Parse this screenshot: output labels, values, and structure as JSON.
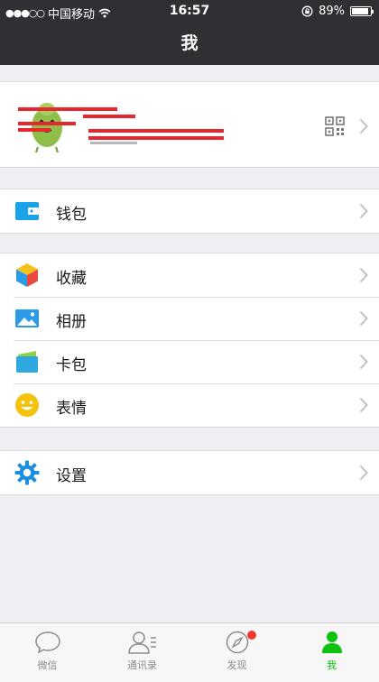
{
  "status_bar": {
    "signal_dots": "●●●○○",
    "carrier": "中国移动",
    "wifi_icon": "wifi-icon",
    "time": "16:57",
    "lock_icon": "orientation-lock-icon",
    "battery_percent": "89%",
    "battery_level": 0.89
  },
  "nav": {
    "title": "我"
  },
  "profile": {
    "icons": [
      "avatar",
      "qr-code-icon",
      "chevron-right-icon"
    ]
  },
  "menu": {
    "wallet": {
      "label": "钱包",
      "icon": "wallet-icon",
      "color": "#1aa3e8"
    },
    "favorites": {
      "label": "收藏",
      "icon": "favorites-cube-icon"
    },
    "album": {
      "label": "相册",
      "icon": "photo-album-icon",
      "color": "#2a9be8"
    },
    "cards": {
      "label": "卡包",
      "icon": "card-pack-icon"
    },
    "stickers": {
      "label": "表情",
      "icon": "smiley-icon",
      "color": "#f5c20e"
    },
    "settings": {
      "label": "设置",
      "icon": "gear-icon",
      "color": "#1a8fe0"
    }
  },
  "tabs": [
    {
      "label": "微信",
      "icon": "chat-bubble-icon",
      "active": false
    },
    {
      "label": "通讯录",
      "icon": "contacts-icon",
      "active": false
    },
    {
      "label": "发现",
      "icon": "compass-icon",
      "active": false,
      "badge": true
    },
    {
      "label": "我",
      "icon": "person-icon",
      "active": true
    }
  ],
  "colors": {
    "header_bg": "#2e3034",
    "active_tab": "#0ec20e",
    "badge": "#f43530",
    "page_bg": "#efeff4"
  }
}
